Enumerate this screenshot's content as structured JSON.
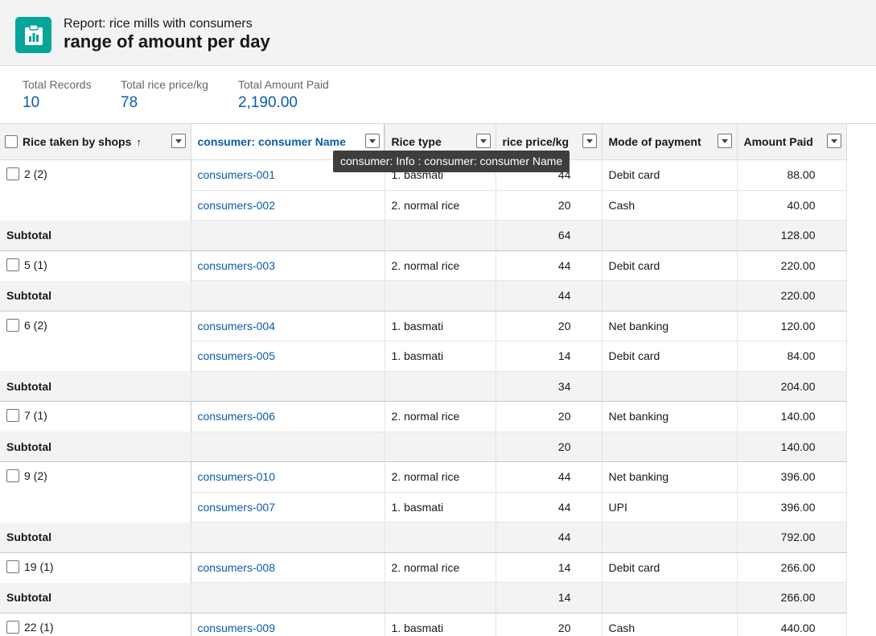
{
  "header": {
    "eyebrow": "Report: rice mills with consumers",
    "title": "range of amount per day",
    "icon": "report-icon"
  },
  "summary": [
    {
      "label": "Total Records",
      "value": "10"
    },
    {
      "label": "Total rice price/kg",
      "value": "78"
    },
    {
      "label": "Total Amount Paid",
      "value": "2,190.00"
    }
  ],
  "columns": {
    "group": "Rice taken by shops",
    "name": "consumer: consumer Name",
    "type": "Rice type",
    "price": "rice price/kg",
    "mode": "Mode of payment",
    "amount": "Amount Paid"
  },
  "tooltip": "consumer: Info : consumer: consumer Name",
  "subtotal_label": "Subtotal",
  "groups": [
    {
      "label": "2 (2)",
      "rows": [
        {
          "name": "consumers-001",
          "type": "1. basmati",
          "price": "44",
          "mode": "Debit card",
          "amount": "88.00"
        },
        {
          "name": "consumers-002",
          "type": "2. normal rice",
          "price": "20",
          "mode": "Cash",
          "amount": "40.00"
        }
      ],
      "subtotal_price": "64",
      "subtotal_amount": "128.00"
    },
    {
      "label": "5 (1)",
      "rows": [
        {
          "name": "consumers-003",
          "type": "2. normal rice",
          "price": "44",
          "mode": "Debit card",
          "amount": "220.00"
        }
      ],
      "subtotal_price": "44",
      "subtotal_amount": "220.00"
    },
    {
      "label": "6 (2)",
      "rows": [
        {
          "name": "consumers-004",
          "type": "1. basmati",
          "price": "20",
          "mode": "Net banking",
          "amount": "120.00"
        },
        {
          "name": "consumers-005",
          "type": "1. basmati",
          "price": "14",
          "mode": "Debit card",
          "amount": "84.00"
        }
      ],
      "subtotal_price": "34",
      "subtotal_amount": "204.00"
    },
    {
      "label": "7 (1)",
      "rows": [
        {
          "name": "consumers-006",
          "type": "2. normal rice",
          "price": "20",
          "mode": "Net banking",
          "amount": "140.00"
        }
      ],
      "subtotal_price": "20",
      "subtotal_amount": "140.00"
    },
    {
      "label": "9 (2)",
      "rows": [
        {
          "name": "consumers-010",
          "type": "2. normal rice",
          "price": "44",
          "mode": "Net banking",
          "amount": "396.00"
        },
        {
          "name": "consumers-007",
          "type": "1. basmati",
          "price": "44",
          "mode": "UPI",
          "amount": "396.00"
        }
      ],
      "subtotal_price": "44",
      "subtotal_amount": "792.00"
    },
    {
      "label": "19 (1)",
      "rows": [
        {
          "name": "consumers-008",
          "type": "2. normal rice",
          "price": "14",
          "mode": "Debit card",
          "amount": "266.00"
        }
      ],
      "subtotal_price": "14",
      "subtotal_amount": "266.00"
    },
    {
      "label": "22 (1)",
      "rows": [
        {
          "name": "consumers-009",
          "type": "1. basmati",
          "price": "20",
          "mode": "Cash",
          "amount": "440.00"
        }
      ],
      "subtotal_price": "",
      "subtotal_amount": ""
    }
  ]
}
